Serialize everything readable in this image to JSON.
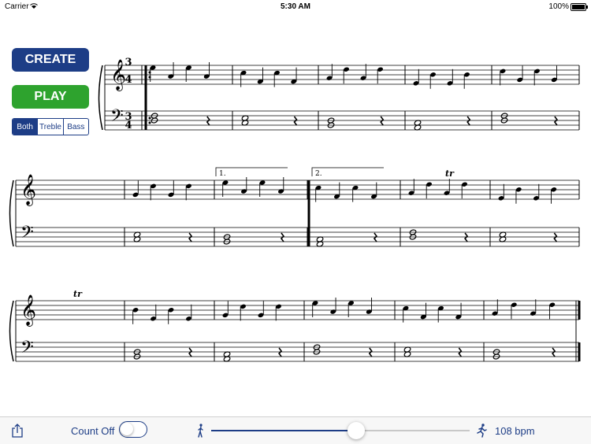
{
  "status_bar": {
    "carrier": "Carrier",
    "time": "5:30 AM",
    "battery": "100%"
  },
  "buttons": {
    "create": "CREATE",
    "play": "PLAY"
  },
  "staff_selector": {
    "options": [
      "Both",
      "Treble",
      "Bass"
    ],
    "selected": "Both"
  },
  "score": {
    "time_signature": {
      "top": "3",
      "bottom": "4"
    },
    "volta_1": "1.",
    "volta_2": "2.",
    "trill": "tr"
  },
  "toolbar": {
    "count_label": "Count Off",
    "count_on": false,
    "tempo_text": "108 bpm",
    "tempo_fraction": 0.56
  },
  "colors": {
    "accent": "#1d3d86",
    "play": "#2ea32e"
  },
  "icons": [
    "wifi-icon",
    "battery-icon",
    "share-icon",
    "walk-icon",
    "run-icon"
  ]
}
